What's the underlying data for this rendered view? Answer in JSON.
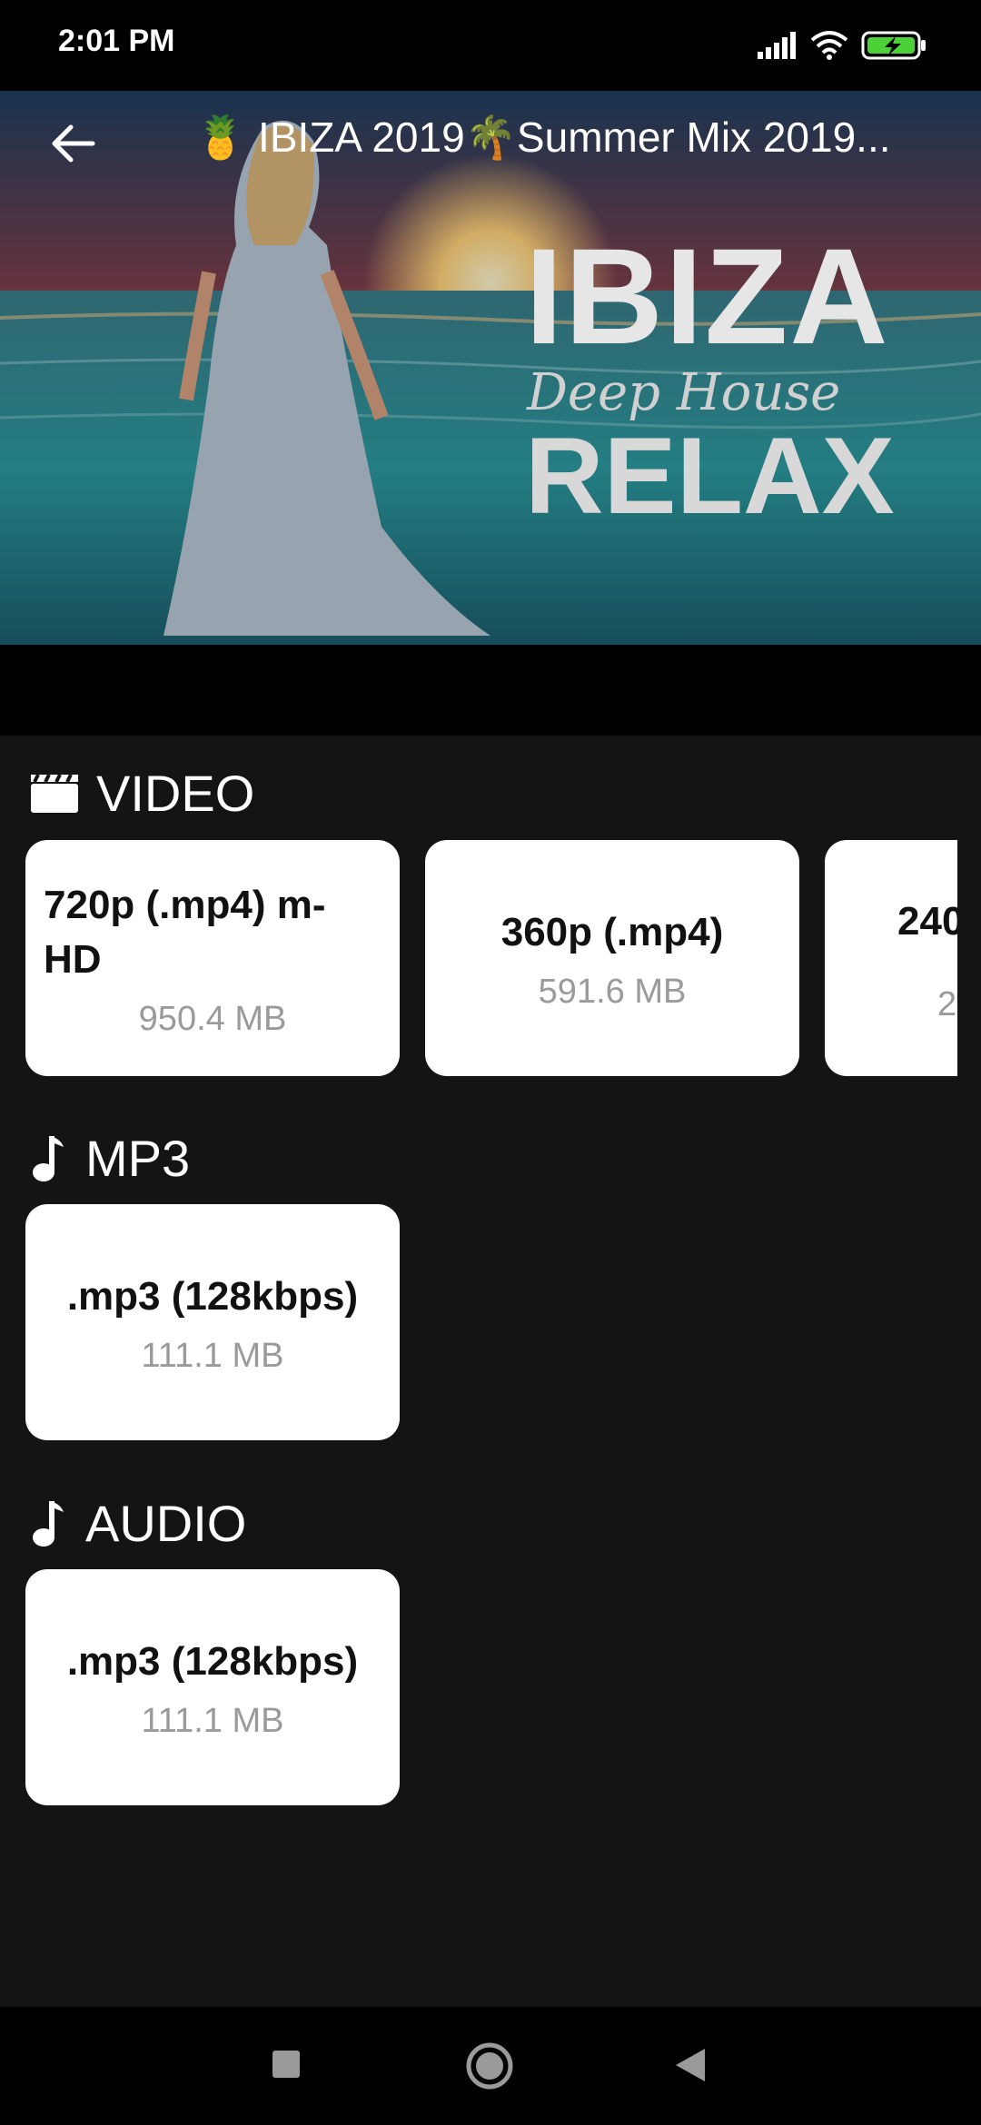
{
  "status": {
    "time": "2:01 PM"
  },
  "header": {
    "title": "🍍 IBIZA 2019🌴Summer Mix 2019..."
  },
  "hero_text": {
    "line1": "IBIZA",
    "line2": "Deep House",
    "line3": "RELAX"
  },
  "sections": {
    "video": {
      "label": "VIDEO",
      "cards": [
        {
          "title": "720p (.mp4) m-HD",
          "size": "950.4 MB"
        },
        {
          "title": "360p (.mp4)",
          "size": "591.6 MB"
        },
        {
          "title": "240",
          "size": "2"
        }
      ]
    },
    "mp3": {
      "label": "MP3",
      "cards": [
        {
          "title": ".mp3 (128kbps)",
          "size": "111.1 MB"
        }
      ]
    },
    "audio": {
      "label": "AUDIO",
      "cards": [
        {
          "title": ".mp3 (128kbps)",
          "size": "111.1 MB"
        }
      ]
    }
  },
  "colors": {
    "background": "#141414",
    "card": "#ffffff",
    "muted": "#9a9a9a",
    "battery": "#4cd137"
  }
}
